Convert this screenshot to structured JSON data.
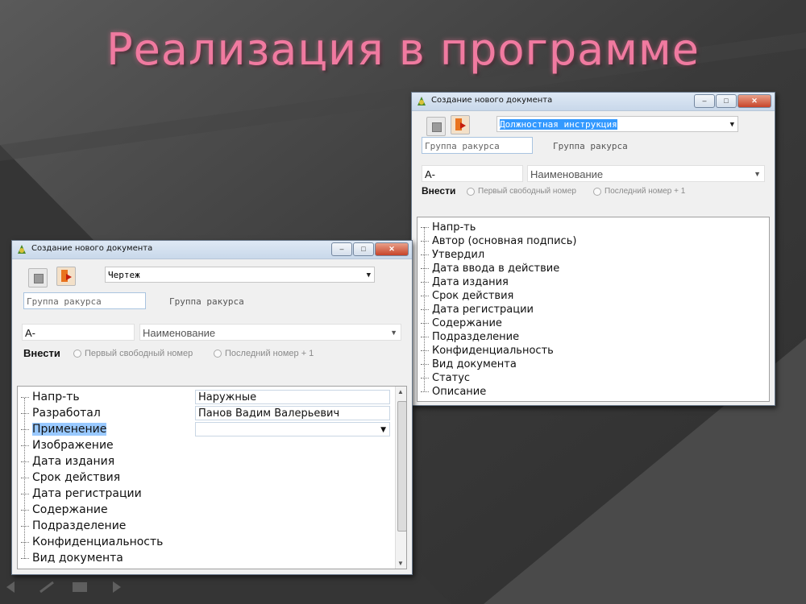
{
  "slide": {
    "title": "Реализация в программе"
  },
  "window_back": {
    "title": "Создание нового документа",
    "doc_type": "Должностная инструкция",
    "group_field_placeholder": "Группа ракурса",
    "group_label": "Группа ракурса",
    "code_value": "А-",
    "name_placeholder": "Наименование",
    "vnesti_label": "Внести",
    "radio_first": "Первый свободный номер",
    "radio_last": "Последний номер + 1",
    "tree_items": [
      "Напр-ть",
      "Автор (основная подпись)",
      "Утвердил",
      "Дата ввода в действие",
      "Дата издания",
      "Срок действия",
      "Дата регистрации",
      "Содержание",
      "Подразделение",
      "Конфиденциальность",
      "Вид документа",
      "Статус",
      "Описание"
    ]
  },
  "window_front": {
    "title": "Создание нового документа",
    "doc_type": "Чертеж",
    "group_field_placeholder": "Группа ракурса",
    "group_label": "Группа ракурса",
    "code_value": "А-",
    "name_placeholder": "Наименование",
    "vnesti_label": "Внести",
    "radio_first": "Первый свободный номер",
    "radio_last": "Последний номер + 1",
    "tree_items": [
      "Напр-ть",
      "Разработал",
      "Применение",
      "Изображение",
      "Дата издания",
      "Срок действия",
      "Дата регистрации",
      "Содержание",
      "Подразделение",
      "Конфиденциальность",
      "Вид документа"
    ],
    "selected_item": "Применение",
    "values": {
      "napr": "Наружные",
      "developer": "Панов Вадим Валерьевич",
      "primenenie": ""
    }
  },
  "colors": {
    "title_pink": "#f07aa0",
    "selection_blue": "#3399ff",
    "close_red": "#c7442a"
  }
}
